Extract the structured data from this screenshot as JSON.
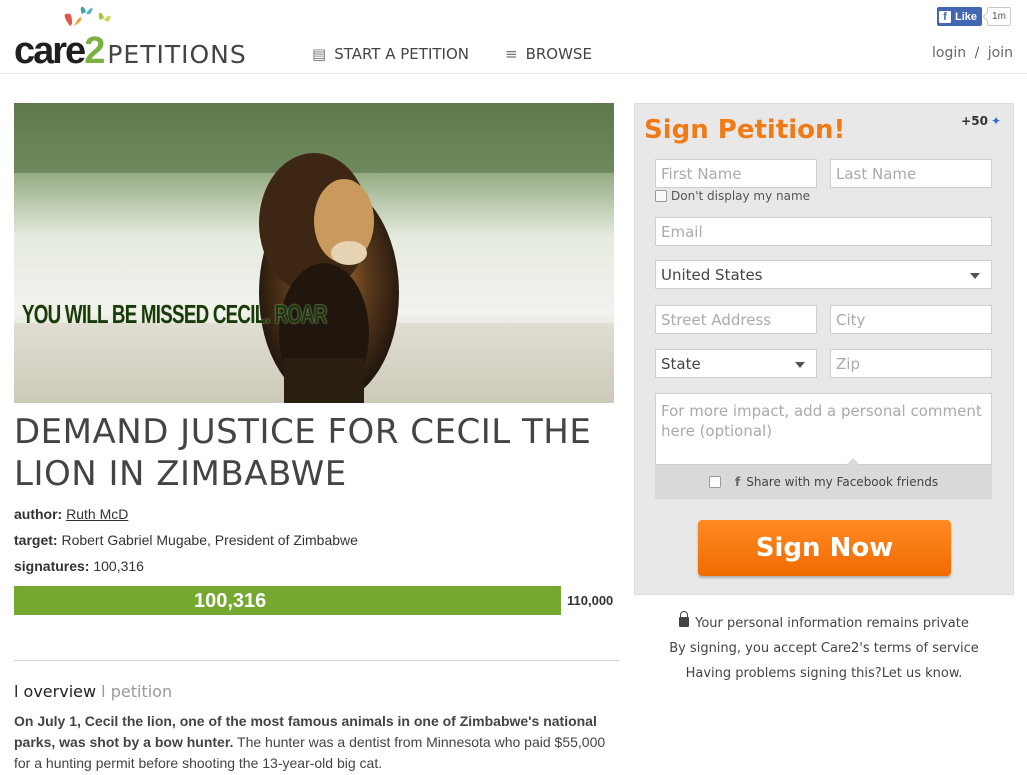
{
  "header": {
    "logo_brand": "care2",
    "logo_product": "PETITIONS",
    "nav": [
      {
        "label": "START A PETITION",
        "icon": "clipboard-icon"
      },
      {
        "label": "BROWSE",
        "icon": "list-icon"
      }
    ],
    "login": "login",
    "divider": "/",
    "join": "join",
    "facebook": {
      "like": "Like",
      "count": "1m"
    }
  },
  "hero": {
    "caption": "YOU WILL BE MISSED CECIL. ROAR"
  },
  "petition": {
    "title": "DEMAND JUSTICE FOR CECIL THE LION IN ZIMBABWE",
    "author_label": "author:",
    "author": "Ruth McD",
    "target_label": "target:",
    "target": "Robert Gabriel Mugabe, President of Zimbabwe",
    "signatures_label": "signatures:",
    "signatures": "100,316",
    "progress_label": "100,316",
    "progress_fraction": 0.912,
    "goal": "110,000",
    "tab_active_prefix": "l",
    "tab_active": "overview",
    "tab_divider": "l",
    "tab_inactive": "petition",
    "desc_bold": "On July 1, Cecil the lion, one of the most famous animals in one of Zimbabwe's national parks, was shot by a bow hunter.",
    "desc_rest": " The hunter was a dentist from Minnesota who paid $55,000 for a hunting permit before shooting the 13-year-old big cat."
  },
  "form": {
    "title": "Sign Petition!",
    "points": "+50",
    "first_name": "First Name",
    "last_name": "Last Name",
    "hide_name": "Don't display my name",
    "email": "Email",
    "country": "United States",
    "street": "Street Address",
    "city": "City",
    "state": "State",
    "zip": "Zip",
    "comment": "For more impact, add a personal comment here (optional)",
    "share": "Share with my Facebook friends",
    "submit": "Sign Now"
  },
  "notes": {
    "privacy": "Your personal information remains private",
    "terms": "By signing, you accept Care2's terms of service",
    "problems": "Having problems signing this?Let us know."
  },
  "colors": {
    "accent": "#f07b16",
    "progress": "#74a82e",
    "facebook": "#4267b2"
  }
}
